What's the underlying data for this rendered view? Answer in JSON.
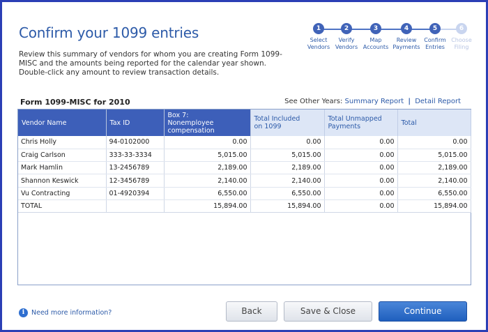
{
  "header": {
    "title": "Confirm your 1099 entries",
    "description": "Review this summary of vendors for whom you are creating Form 1099-MISC and the amounts being reported for the calendar year shown. Double-click any amount to review transaction details."
  },
  "steps": [
    {
      "number": "1",
      "label_line1": "Select",
      "label_line2": "Vendors",
      "enabled": true
    },
    {
      "number": "2",
      "label_line1": "Verify",
      "label_line2": "Vendors",
      "enabled": true
    },
    {
      "number": "3",
      "label_line1": "Map",
      "label_line2": "Accounts",
      "enabled": true
    },
    {
      "number": "4",
      "label_line1": "Review",
      "label_line2": "Payments",
      "enabled": true
    },
    {
      "number": "5",
      "label_line1": "Confirm",
      "label_line2": "Entries",
      "enabled": true
    },
    {
      "number": "6",
      "label_line1": "Choose",
      "label_line2": "Filing",
      "enabled": false
    }
  ],
  "form": {
    "title": "Form 1099-MISC for 2010",
    "other_years_label": "See Other Years:",
    "summary_report_link": "Summary Report",
    "separator": "|",
    "detail_report_link": "Detail Report"
  },
  "table": {
    "columns": [
      {
        "line1": "Vendor Name",
        "line2": ""
      },
      {
        "line1": "Tax ID",
        "line2": ""
      },
      {
        "line1": "Box 7:",
        "line2": "Nonemployee compensation"
      },
      {
        "line1": "Total Included",
        "line2": "on 1099"
      },
      {
        "line1": "Total Unmapped",
        "line2": "Payments"
      },
      {
        "line1": "Total",
        "line2": ""
      }
    ],
    "rows": [
      [
        "Chris Holly",
        "94-0102000",
        "0.00",
        "0.00",
        "0.00",
        "0.00"
      ],
      [
        "Craig Carlson",
        "333-33-3334",
        "5,015.00",
        "5,015.00",
        "0.00",
        "5,015.00"
      ],
      [
        "Mark Hamlin",
        "13-2456789",
        "2,189.00",
        "2,189.00",
        "0.00",
        "2,189.00"
      ],
      [
        "Shannon Keswick",
        "12-3456789",
        "2,140.00",
        "2,140.00",
        "0.00",
        "2,140.00"
      ],
      [
        "Vu Contracting",
        "01-4920394",
        "6,550.00",
        "6,550.00",
        "0.00",
        "6,550.00"
      ],
      [
        "TOTAL",
        "",
        "15,894.00",
        "15,894.00",
        "0.00",
        "15,894.00"
      ]
    ]
  },
  "footer": {
    "help_icon": "info-icon",
    "help_link": "Need more information?",
    "back_label": "Back",
    "save_close_label": "Save & Close",
    "continue_label": "Continue"
  },
  "colors": {
    "frame": "#2b3fb5",
    "title": "#2c5aa8",
    "header_dark": "#3d5fb9",
    "header_light": "#dde6f6",
    "primary_button": "#1f5fbe"
  }
}
